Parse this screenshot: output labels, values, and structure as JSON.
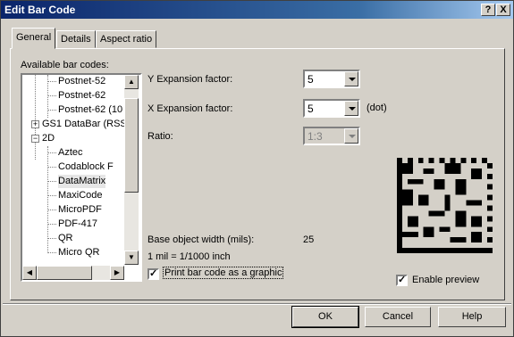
{
  "window": {
    "title": "Edit Bar Code",
    "help_btn": "?",
    "close_btn": "X"
  },
  "tabs": [
    {
      "label": "General"
    },
    {
      "label": "Details"
    },
    {
      "label": "Aspect ratio"
    }
  ],
  "general": {
    "available_label": "Available bar codes:",
    "tree": [
      "Postnet-52",
      "Postnet-62",
      "Postnet-62 (10",
      "GS1 DataBar (RSS",
      "2D",
      "Aztec",
      "Codablock F",
      "DataMatrix",
      "MaxiCode",
      "MicroPDF",
      "PDF-417",
      "QR",
      "Micro QR"
    ],
    "y_label": "Y Expansion factor:",
    "y_value": "5",
    "x_label": "X Expansion factor:",
    "x_value": "5",
    "x_unit": "(dot)",
    "ratio_label": "Ratio:",
    "ratio_value": "1:3",
    "base_label": "Base object width (mils):",
    "base_value": "25",
    "mil_note": "1 mil = 1/1000 inch",
    "print_graphic_label": "Print bar code as a graphic",
    "print_graphic_checked": true,
    "enable_preview_label": "Enable preview",
    "enable_preview_checked": true,
    "preview_symbol": "DataMatrix"
  },
  "buttons": {
    "ok": "OK",
    "cancel": "Cancel",
    "help": "Help"
  }
}
